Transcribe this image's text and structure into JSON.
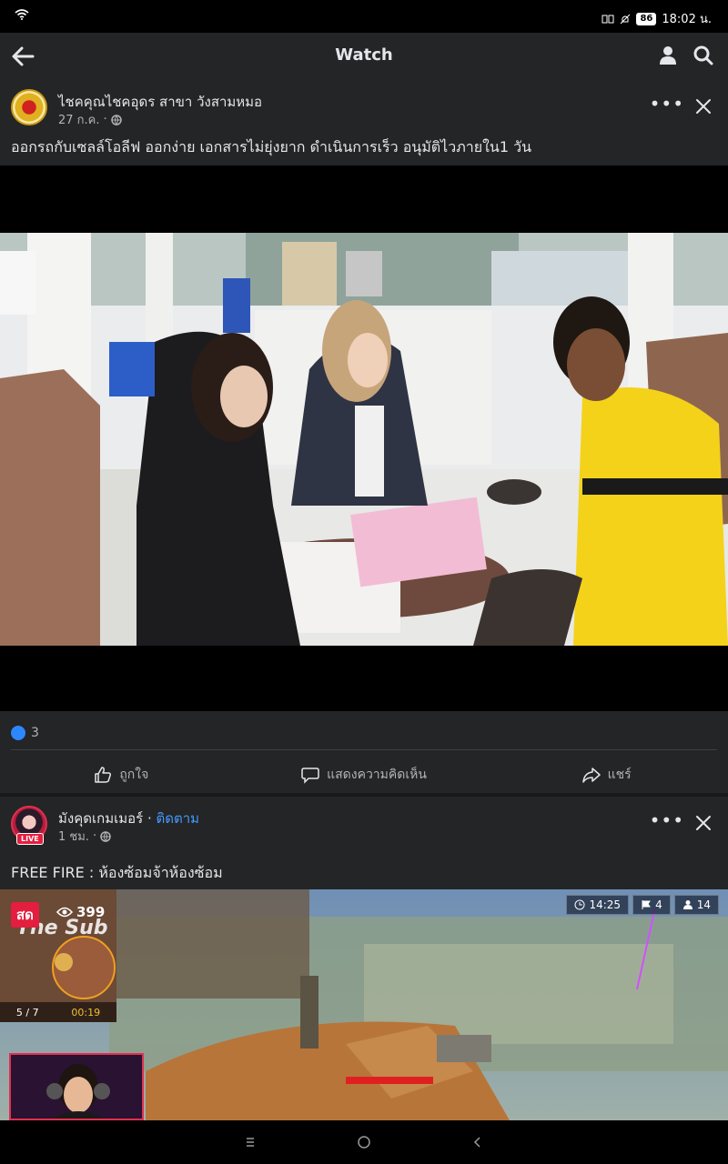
{
  "status_bar": {
    "time": "18:02 น.",
    "battery": "86"
  },
  "header": {
    "title": "Watch"
  },
  "post1": {
    "page_name": "ไชคคุณไชคอุดร สาขา วังสามหมอ",
    "time": "27 ก.ค.",
    "caption": "ออกรถกับเซลล์โอลีฟ ออกง่าย เอกสารไม่ยุ่งยาก ดำเนินการเร็ว อนุมัติไวภายใน1 วัน",
    "likes": "3",
    "actions": {
      "like": "ถูกใจ",
      "comment": "แสดงความคิดเห็น",
      "share": "แชร์"
    }
  },
  "post2": {
    "page_name": "มังคุดเกมเมอร์",
    "follow": "ติดตาม",
    "live_badge": "LIVE",
    "time": "1 ชม.",
    "caption": "FREE FIRE : ห้องซ้อมจ้าห้องซ้อม",
    "live_label": "สด",
    "viewers": "399",
    "hud": {
      "timer": "14:25",
      "flags": "4",
      "players": "14"
    },
    "minimap_text": "The Sub",
    "stats": {
      "squad": "5 / 7",
      "clock": "00:19"
    }
  }
}
